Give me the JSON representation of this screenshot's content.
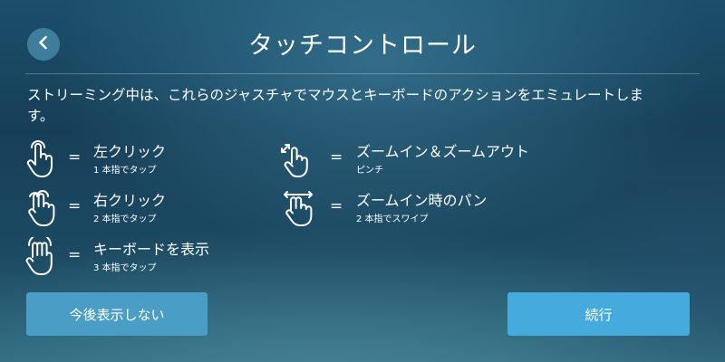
{
  "header": {
    "title": "タッチコントロール",
    "back_icon": "chevron-left-icon"
  },
  "description": "ストリーミング中は、これらのジャスチャでマウスとキーボードのアクションをエミュレートします。",
  "equals_sign": "=",
  "gestures": [
    {
      "icon": "one-finger-tap-icon",
      "label": "左クリック",
      "sub": "1 本指でタップ"
    },
    {
      "icon": "two-finger-tap-icon",
      "label": "右クリック",
      "sub": "2 本指でタップ"
    },
    {
      "icon": "three-finger-tap-icon",
      "label": "キーボードを表示",
      "sub": "3 本指でタップ"
    },
    {
      "icon": "pinch-zoom-icon",
      "label": "ズームイン＆ズームアウト",
      "sub": "ピンチ"
    },
    {
      "icon": "two-finger-swipe-icon",
      "label": "ズームイン時のパン",
      "sub": "2 本指でスワイプ"
    }
  ],
  "buttons": {
    "dont_show_again": "今後表示しない",
    "continue": "続行"
  },
  "colors": {
    "button_primary": "#45abdc",
    "back_button": "#3e7d9c"
  }
}
